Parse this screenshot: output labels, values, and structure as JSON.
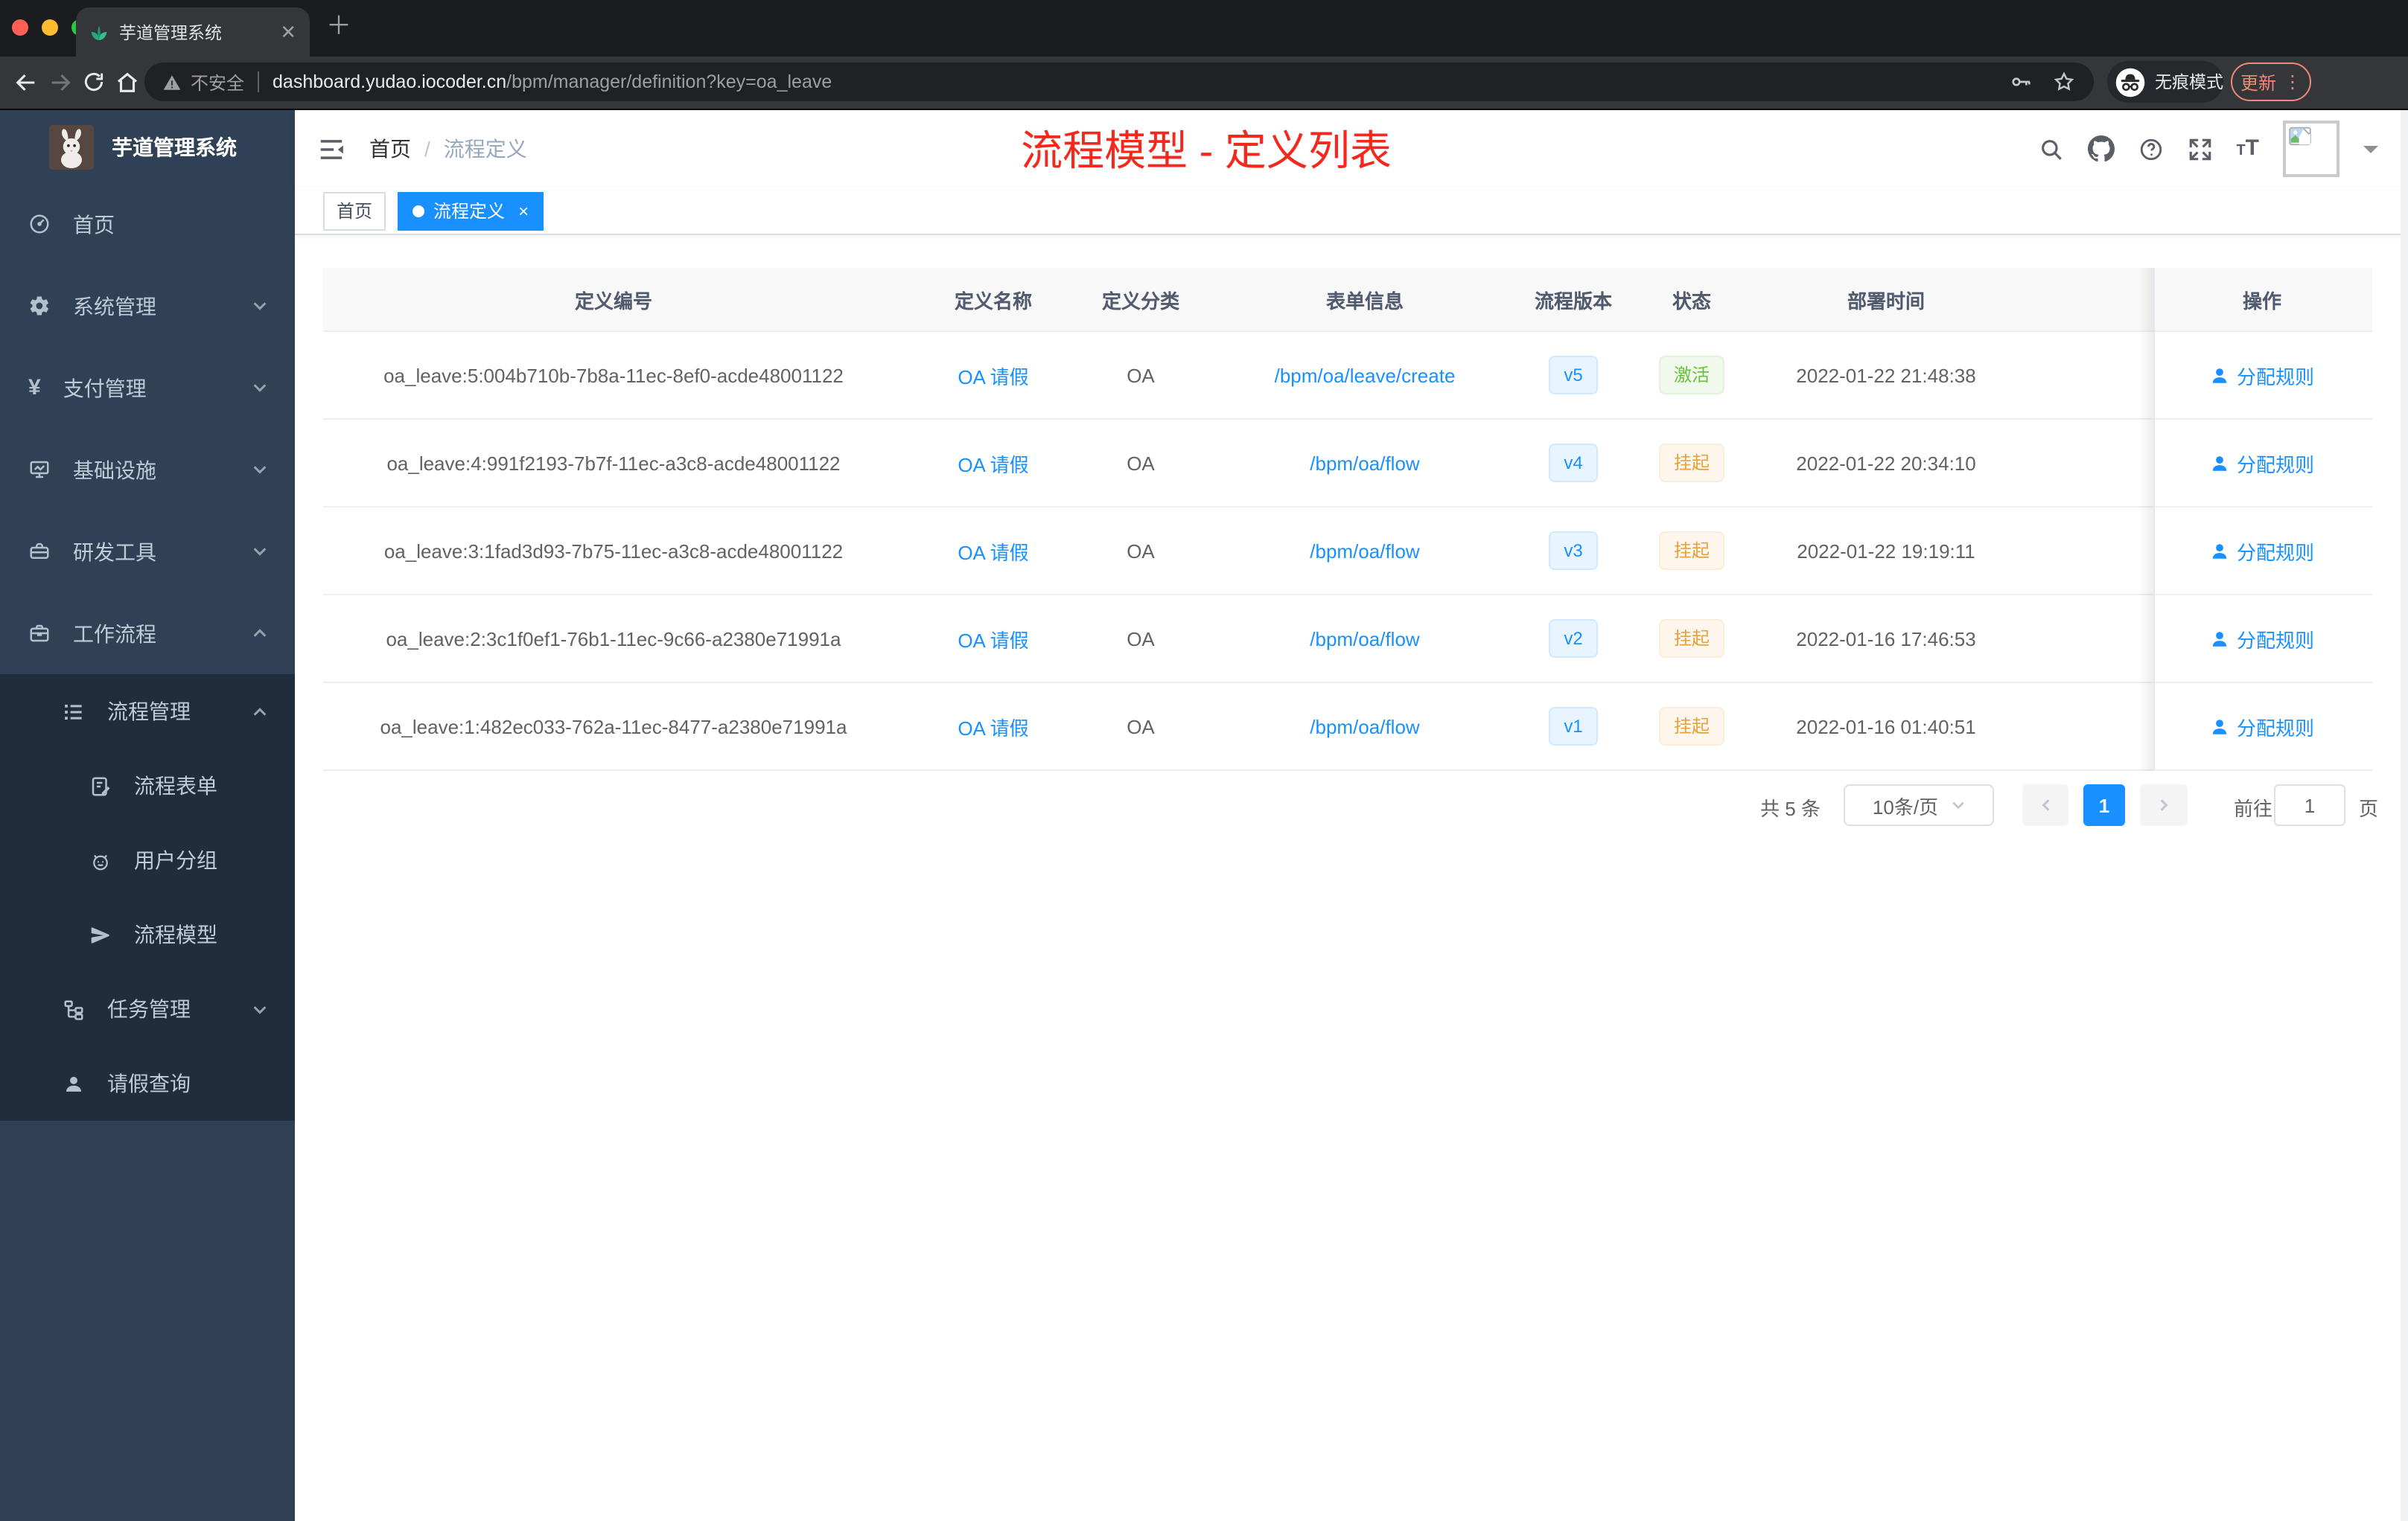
{
  "colors": {
    "accent": "#1890ff",
    "success": "#67c23a",
    "warning": "#e6a23c",
    "annotation_red": "#f5281d",
    "sidebar_bg": "#304156",
    "submenu_bg": "#1f2d3d",
    "update_button": "#ef8878"
  },
  "browser": {
    "tab_title": "芋道管理系统",
    "url_security": "不安全",
    "url_host": "dashboard.yudao.iocoder.cn",
    "url_path": "/bpm/manager/definition?key=oa_leave",
    "incognito_label": "无痕模式",
    "update_label": "更新"
  },
  "sidebar": {
    "app_title": "芋道管理系统",
    "items": [
      {
        "label": "首页"
      },
      {
        "label": "系统管理"
      },
      {
        "label": "支付管理"
      },
      {
        "label": "基础设施"
      },
      {
        "label": "研发工具"
      },
      {
        "label": "工作流程"
      },
      {
        "label": "流程管理"
      },
      {
        "label": "流程表单"
      },
      {
        "label": "用户分组"
      },
      {
        "label": "流程模型"
      },
      {
        "label": "任务管理"
      },
      {
        "label": "请假查询"
      }
    ]
  },
  "navbar": {
    "breadcrumb": [
      "首页",
      "流程定义"
    ],
    "annotation": "流程模型 - 定义列表"
  },
  "tags": [
    {
      "label": "首页"
    },
    {
      "label": "流程定义"
    }
  ],
  "table": {
    "columns": [
      "定义编号",
      "定义名称",
      "定义分类",
      "表单信息",
      "流程版本",
      "状态",
      "部署时间",
      "操作"
    ],
    "rows": [
      {
        "id": "oa_leave:5:004b710b-7b8a-11ec-8ef0-acde48001122",
        "name": "OA 请假",
        "category": "OA",
        "form": "/bpm/oa/leave/create",
        "version": "v5",
        "status": "激活",
        "status_type": "success",
        "deploy_time": "2022-01-22 21:48:38",
        "action": "分配规则"
      },
      {
        "id": "oa_leave:4:991f2193-7b7f-11ec-a3c8-acde48001122",
        "name": "OA 请假",
        "category": "OA",
        "form": "/bpm/oa/flow",
        "version": "v4",
        "status": "挂起",
        "status_type": "warning",
        "deploy_time": "2022-01-22 20:34:10",
        "action": "分配规则"
      },
      {
        "id": "oa_leave:3:1fad3d93-7b75-11ec-a3c8-acde48001122",
        "name": "OA 请假",
        "category": "OA",
        "form": "/bpm/oa/flow",
        "version": "v3",
        "status": "挂起",
        "status_type": "warning",
        "deploy_time": "2022-01-22 19:19:11",
        "action": "分配规则"
      },
      {
        "id": "oa_leave:2:3c1f0ef1-76b1-11ec-9c66-a2380e71991a",
        "name": "OA 请假",
        "category": "OA",
        "form": "/bpm/oa/flow",
        "version": "v2",
        "status": "挂起",
        "status_type": "warning",
        "deploy_time": "2022-01-16 17:46:53",
        "action": "分配规则"
      },
      {
        "id": "oa_leave:1:482ec033-762a-11ec-8477-a2380e71991a",
        "name": "OA 请假",
        "category": "OA",
        "form": "/bpm/oa/flow",
        "version": "v1",
        "status": "挂起",
        "status_type": "warning",
        "deploy_time": "2022-01-16 01:40:51",
        "action": "分配规则"
      }
    ]
  },
  "pagination": {
    "total": "共 5 条",
    "page_size": "10条/页",
    "page": "1",
    "goto": "前往",
    "goto_value": "1",
    "unit": "页"
  }
}
